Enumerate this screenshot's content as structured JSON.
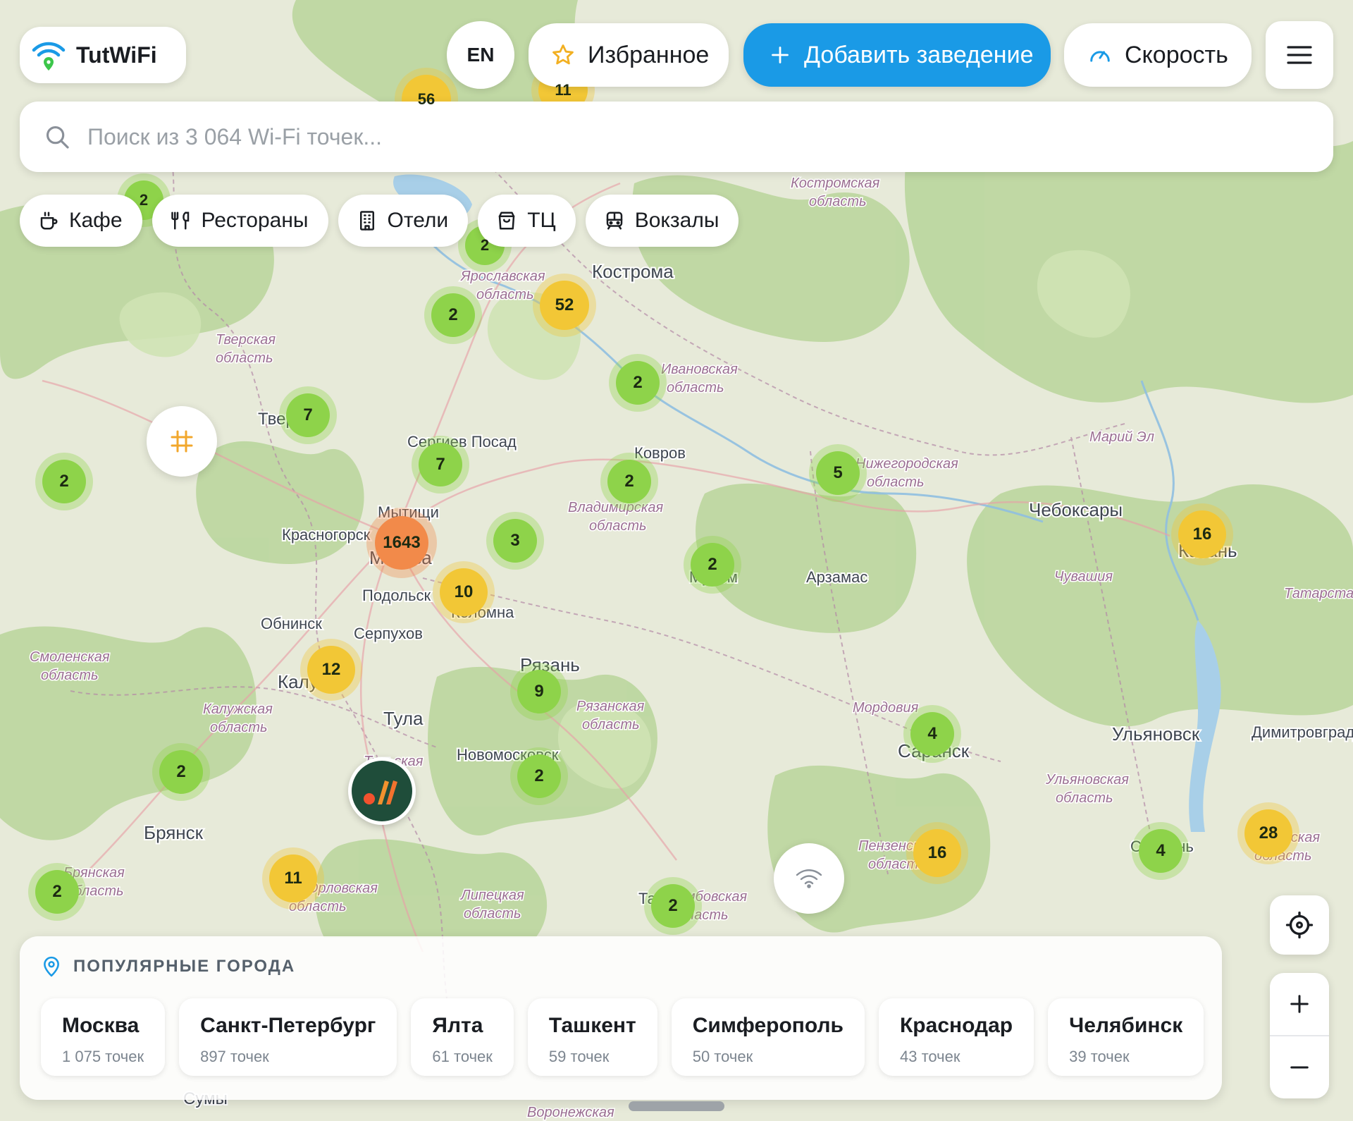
{
  "header": {
    "brand": "TutWiFi",
    "lang": "EN",
    "favorites": "Избранное",
    "add_place": "Добавить заведение",
    "speed": "Скорость"
  },
  "search": {
    "placeholder": "Поиск из 3 064 Wi-Fi точек..."
  },
  "categories": [
    "Кафе",
    "Рестораны",
    "Отели",
    "ТЦ",
    "Вокзалы"
  ],
  "popular": {
    "title": "ПОПУЛЯРНЫЕ ГОРОДА",
    "cities": [
      {
        "name": "Москва",
        "count": "1 075 точек"
      },
      {
        "name": "Санкт-Петербург",
        "count": "897 точек"
      },
      {
        "name": "Ялта",
        "count": "61 точек"
      },
      {
        "name": "Ташкент",
        "count": "59 точек"
      },
      {
        "name": "Симферополь",
        "count": "50 точек"
      },
      {
        "name": "Краснодар",
        "count": "43 точек"
      },
      {
        "name": "Челябинск",
        "count": "39 точек"
      }
    ]
  },
  "map": {
    "cities": [
      "Кострома",
      "Тверь",
      "Сергиев Посад",
      "Ковров",
      "Мытищи",
      "Красногорск",
      "Москва",
      "Подольск",
      "Коломна",
      "Обнинск",
      "Серпухов",
      "Калуга",
      "Тула",
      "Рязань",
      "Новомосковск",
      "Брянск",
      "Арзамас",
      "Чебоксары",
      "Казань",
      "Ульяновск",
      "Саранск",
      "Муром",
      "Сызрань",
      "Димитровград",
      "Тамбов",
      "Сумы"
    ],
    "regions": [
      "Костромская область",
      "Ярославская область",
      "Тверская область",
      "Ивановская область",
      "Владимирская область",
      "Нижегородская область",
      "Марий Эл",
      "Чувашия",
      "Татарстан",
      "Смоленская область",
      "Калужская область",
      "Тульская область",
      "Рязанская область",
      "Мордовия",
      "Ульяновская область",
      "Пензенская область",
      "Брянская область",
      "Орловская область",
      "Липецкая область",
      "Тамбовская область",
      "Самарская область",
      "Воронежская область"
    ],
    "clusters": [
      "56",
      "11",
      "2",
      "2",
      "52",
      "2",
      "2",
      "7",
      "2",
      "7",
      "2",
      "5",
      "16",
      "1643",
      "3",
      "2",
      "10",
      "12",
      "9",
      "4",
      "2",
      "2",
      "2",
      "16",
      "4",
      "28",
      "11",
      "2",
      "2"
    ]
  },
  "icons": [
    "wifi-logo-icon",
    "star-icon",
    "plus-icon",
    "speedometer-icon",
    "menu-icon",
    "search-icon",
    "cafe-icon",
    "restaurant-icon",
    "hotel-icon",
    "mall-icon",
    "station-icon",
    "grid-icon",
    "wifi-icon",
    "crosshair-icon",
    "location-pin-icon"
  ],
  "colors": {
    "accent": "#1a9ae6",
    "cluster_green": "#8ed34a",
    "cluster_yellow": "#f2c736",
    "cluster_orange": "#f28a4a"
  }
}
